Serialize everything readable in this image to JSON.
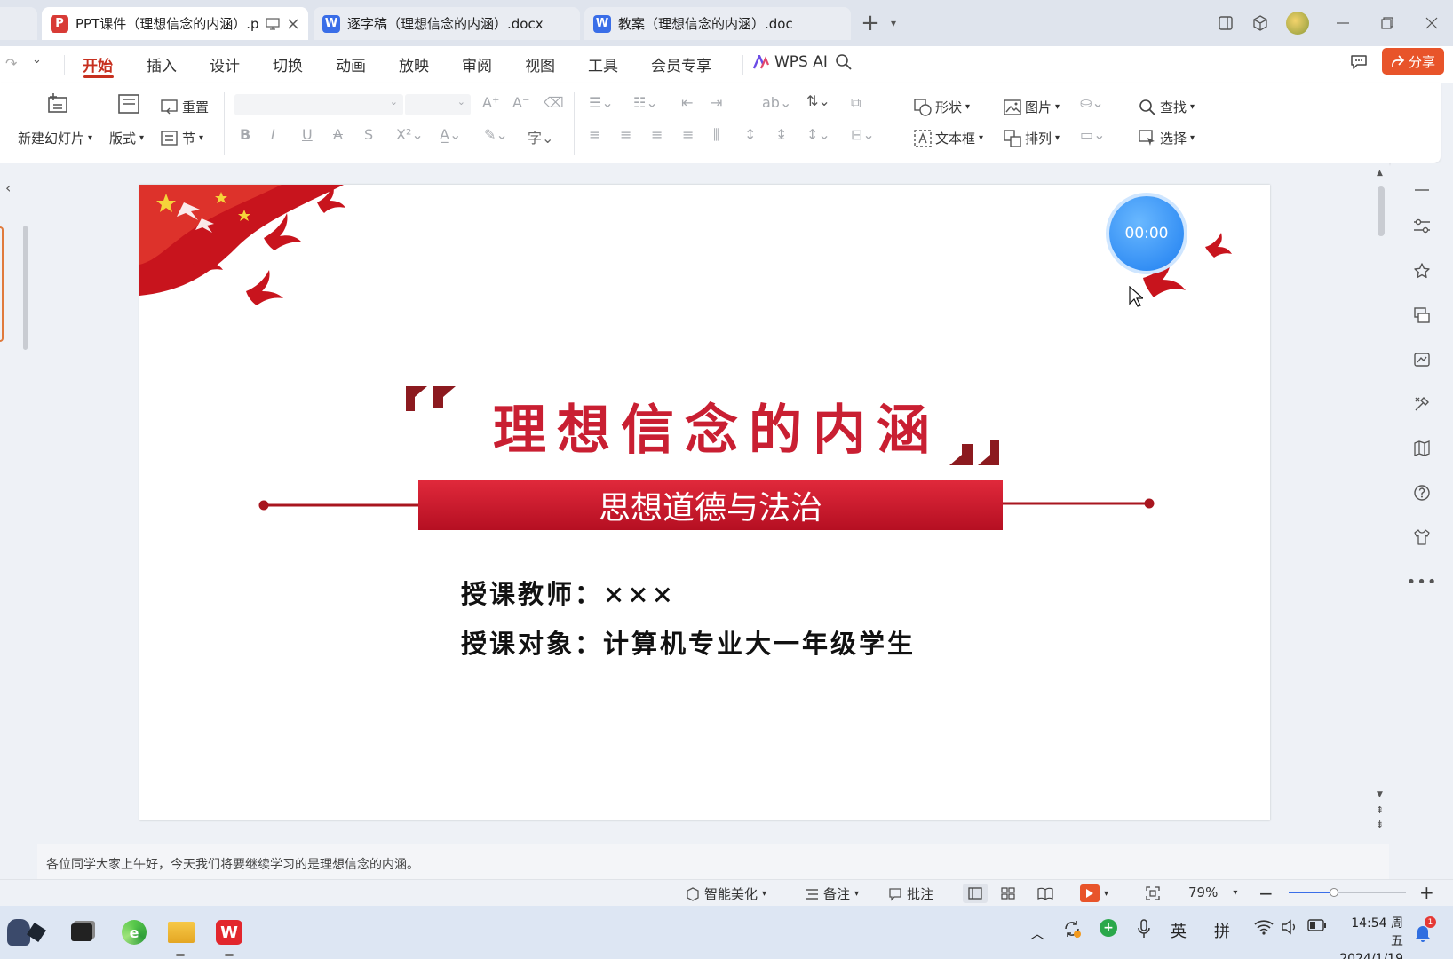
{
  "tabs": [
    {
      "label": "PPT课件（理想信念的内涵）.p",
      "app": "P",
      "active": true
    },
    {
      "label": "逐字稿（理想信念的内涵）.docx",
      "app": "W",
      "active": false
    },
    {
      "label": "教案（理想信念的内涵）.doc",
      "app": "W",
      "active": false
    }
  ],
  "menu": [
    "开始",
    "插入",
    "设计",
    "切换",
    "动画",
    "放映",
    "审阅",
    "视图",
    "工具",
    "会员专享",
    "WPS AI"
  ],
  "share_label": "分享",
  "ribbon": {
    "new_slide": "新建幻灯片",
    "layout": "版式",
    "reset": "重置",
    "section": "节",
    "shape": "形状",
    "picture": "图片",
    "textbox": "文本框",
    "arrange": "排列",
    "find": "查找",
    "select": "选择"
  },
  "slide": {
    "title": "理想信念的内涵",
    "subtitle": "思想道德与法治",
    "teacher": "授课教师：×××",
    "audience": "授课对象：计算机专业大一年级学生",
    "timer": "00:00"
  },
  "notes": "各位同学大家上午好，今天我们将要继续学习的是理想信念的内涵。",
  "status": {
    "beautify": "智能美化",
    "notes": "备注",
    "comment": "批注",
    "zoom": "79%"
  },
  "tray": {
    "ime_lang": "英",
    "ime_mode": "拼",
    "time": "14:54 周五",
    "date": "2024/1/19",
    "notification_count": "1"
  },
  "colors": {
    "accent": "#c7301f",
    "slide_red": "#c91f32",
    "share": "#e8542a"
  }
}
